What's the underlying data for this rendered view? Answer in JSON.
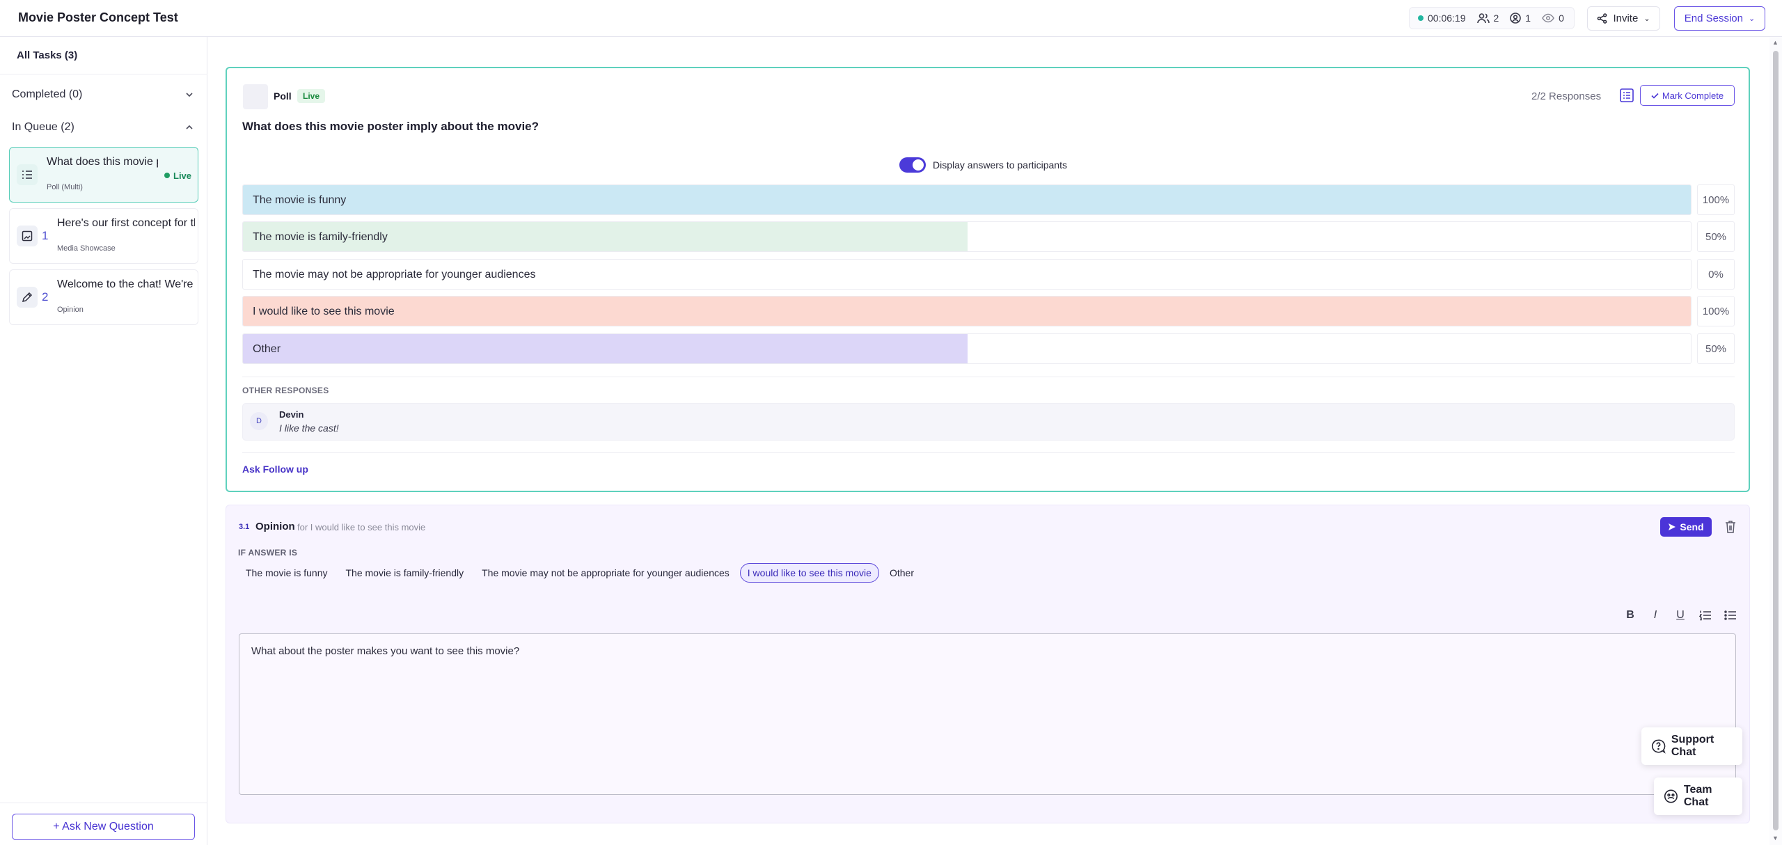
{
  "app": {
    "title": "Movie Poster Concept Test"
  },
  "header": {
    "timer": "00:06:19",
    "participants": "2",
    "observers": "1",
    "viewers": "0",
    "invite_label": "Invite",
    "end_session_label": "End Session"
  },
  "sidebar": {
    "all_tasks": "All Tasks (3)",
    "completed": "Completed (0)",
    "in_queue": "In Queue (2)",
    "tasks": [
      {
        "number": "",
        "title": "What does this movie poster imply about the movie?",
        "type": "Poll (Multi)",
        "status": "Live",
        "icon": "poll-list-icon"
      },
      {
        "number": "1",
        "title": "Here's our first concept for the movie poster",
        "type": "Media Showcase",
        "icon": "image-icon"
      },
      {
        "number": "2",
        "title": "Welcome to the chat! We're excited to hear your thoughts",
        "type": "Opinion",
        "icon": "pencil-icon"
      }
    ],
    "ask_new_question": "+ Ask New Question"
  },
  "poll": {
    "label": "Poll",
    "status": "Live",
    "responses": "2/2 Responses",
    "mark_complete": "Mark Complete",
    "question": "What does this movie poster imply about the movie?",
    "display_toggle_label": "Display answers to participants",
    "display_toggle_on": true,
    "options": [
      {
        "label": "The movie is funny",
        "pct": "100%",
        "fraction": 1.0,
        "color": "#cbe8f4"
      },
      {
        "label": "The movie is family-friendly",
        "pct": "50%",
        "fraction": 0.5,
        "color": "#e2f2e8"
      },
      {
        "label": "The movie may not be appropriate for younger audiences",
        "pct": "0%",
        "fraction": 0.0,
        "color": "#f0e6f5"
      },
      {
        "label": "I would like to see this movie",
        "pct": "100%",
        "fraction": 1.0,
        "color": "#fcd9d1"
      },
      {
        "label": "Other",
        "pct": "50%",
        "fraction": 0.5,
        "color": "#dcd6f8"
      }
    ],
    "other_responses_heading": "OTHER RESPONSES",
    "other_responses": [
      {
        "initial": "D",
        "name": "Devin",
        "text": "I like the cast!"
      }
    ],
    "ask_follow_up": "Ask Follow up"
  },
  "follow_up": {
    "number": "3.1",
    "type": "Opinion",
    "for_text": "for I would like to see this movie",
    "send_label": "Send",
    "if_answer_label": "IF ANSWER IS",
    "chips": [
      {
        "label": "The movie is funny",
        "selected": false
      },
      {
        "label": "The movie is family-friendly",
        "selected": false
      },
      {
        "label": "The movie may not be appropriate for younger audiences",
        "selected": false
      },
      {
        "label": "I would like to see this movie",
        "selected": true
      },
      {
        "label": "Other",
        "selected": false
      }
    ],
    "format_buttons": [
      "B",
      "I",
      "U"
    ],
    "editor_text": "What about the poster makes you want to see this movie?"
  },
  "chat": {
    "support_label": "Support Chat",
    "team_label": "Team Chat"
  },
  "colors": {
    "accent": "#4b34d8",
    "live_border": "#5fd1bd",
    "live_green": "#1f9d63"
  }
}
